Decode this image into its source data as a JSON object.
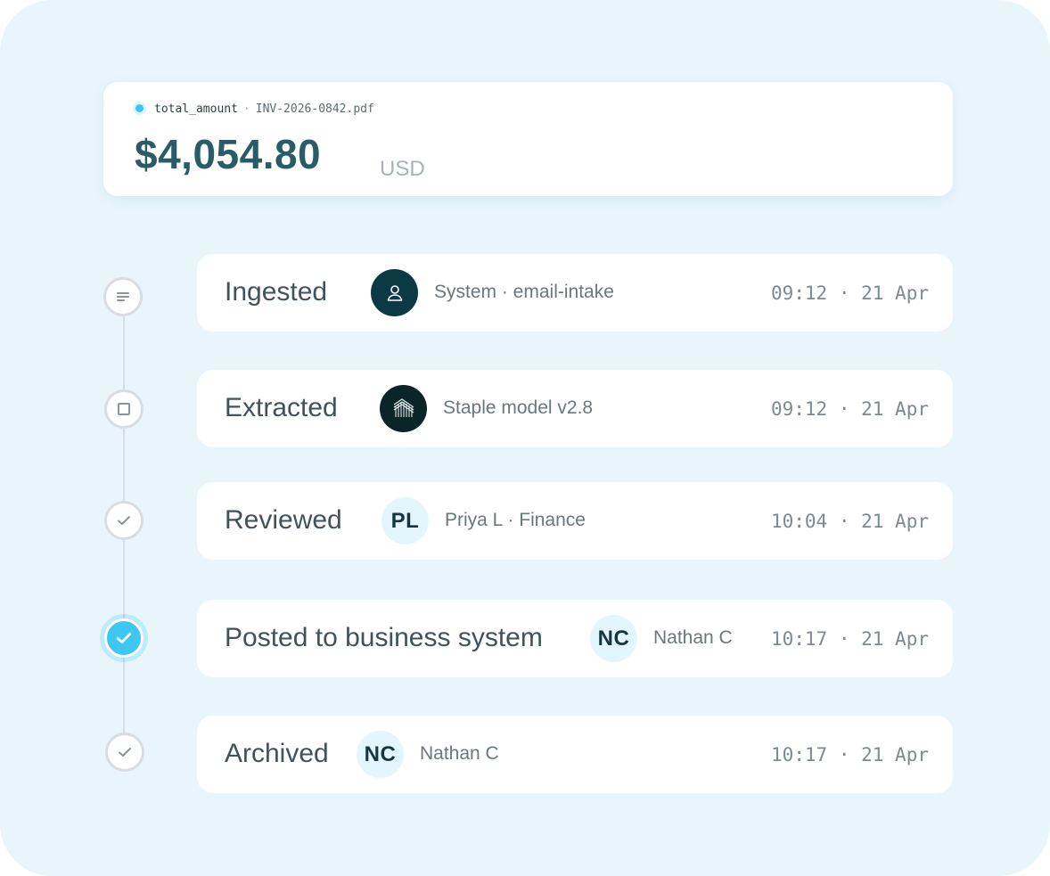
{
  "field": {
    "name": "total_amount",
    "separator": "·",
    "file": "INV-2026-0842.pdf",
    "amount": "$4,054.80",
    "currency": "USD",
    "dot_color": "#3ec6f2"
  },
  "timeline": {
    "active_color": "#3fc7f3",
    "steps": [
      {
        "status": "Ingested",
        "node_icon": "list-icon",
        "avatar_icon": "user-icon",
        "actor": "System · email-intake",
        "time": "09:12 · 21 Apr"
      },
      {
        "status": "Extracted",
        "node_icon": "square-icon",
        "avatar_icon": "staple-logo-icon",
        "actor": "Staple model v2.8",
        "time": "09:12 · 21 Apr"
      },
      {
        "status": "Reviewed",
        "node_icon": "check-icon",
        "avatar_initials": "PL",
        "actor": "Priya L · Finance",
        "time": "10:04 · 21 Apr"
      },
      {
        "status": "Posted to business system",
        "node_icon": "check-icon",
        "active": true,
        "avatar_initials": "NC",
        "actor": "Nathan C",
        "time": "10:17 · 21 Apr"
      },
      {
        "status": "Archived",
        "node_icon": "check-icon",
        "avatar_initials": "NC",
        "actor": "Nathan C",
        "time": "10:17 · 21 Apr"
      }
    ]
  }
}
